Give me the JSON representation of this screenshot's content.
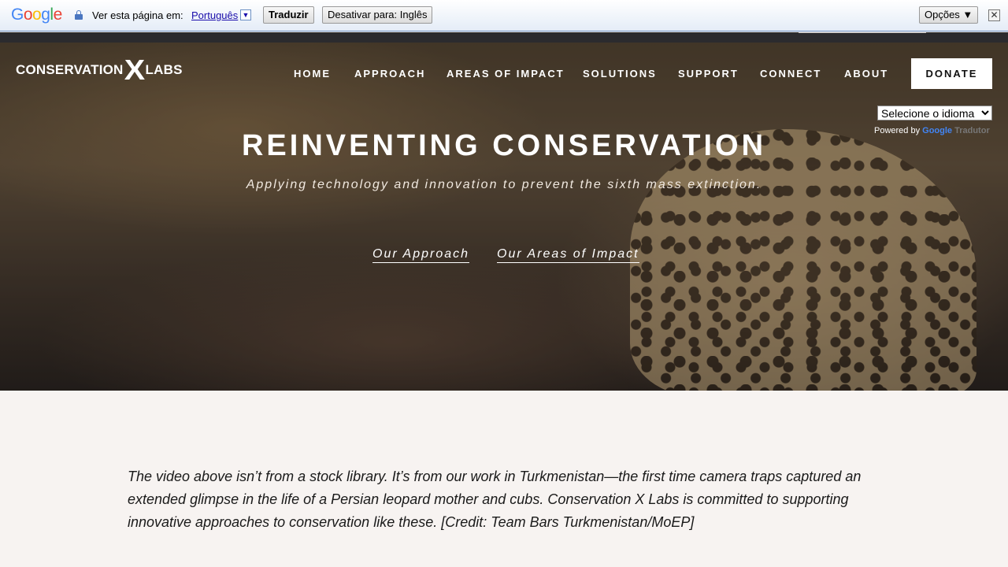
{
  "translate_bar": {
    "logo_letters": [
      {
        "ch": "G",
        "color": "#4285F4"
      },
      {
        "ch": "o",
        "color": "#EA4335"
      },
      {
        "ch": "o",
        "color": "#FBBC05"
      },
      {
        "ch": "g",
        "color": "#4285F4"
      },
      {
        "ch": "l",
        "color": "#34A853"
      },
      {
        "ch": "e",
        "color": "#EA4335"
      }
    ],
    "prompt": "Ver esta página em:",
    "language": "Português",
    "dropdown_glyph": "▼",
    "translate_button": "Traduzir",
    "disable_button": "Desativar para: Inglês",
    "options_button": "Opções ▼",
    "close_glyph": "✕"
  },
  "header": {
    "logo_left": "CONSERVATION",
    "logo_x": "X",
    "logo_right": "LABS",
    "nav": [
      "HOME",
      "APPROACH",
      "AREAS OF IMPACT",
      "SOLUTIONS",
      "SUPPORT",
      "CONNECT",
      "ABOUT"
    ],
    "donate": "DONATE"
  },
  "translate_widget": {
    "select_value": "Selecione o idioma",
    "powered_by": "Powered by",
    "google": "Google",
    "translator": "Tradutor"
  },
  "hero": {
    "title": "REINVENTING CONSERVATION",
    "subtitle": "Applying technology and innovation to prevent the sixth mass extinction.",
    "link_approach": "Our Approach",
    "link_impact": "Our Areas of Impact"
  },
  "body": {
    "paragraph": "The video above isn’t from a stock library. It’s from our work in Turkmenistan—the first time camera traps captured an extended glimpse in the life of a Persian leopard mother and cubs. Conservation X Labs is committed to supporting innovative approaches to conservation like these. [Credit: Team Bars Turkmenistan/MoEP]"
  }
}
